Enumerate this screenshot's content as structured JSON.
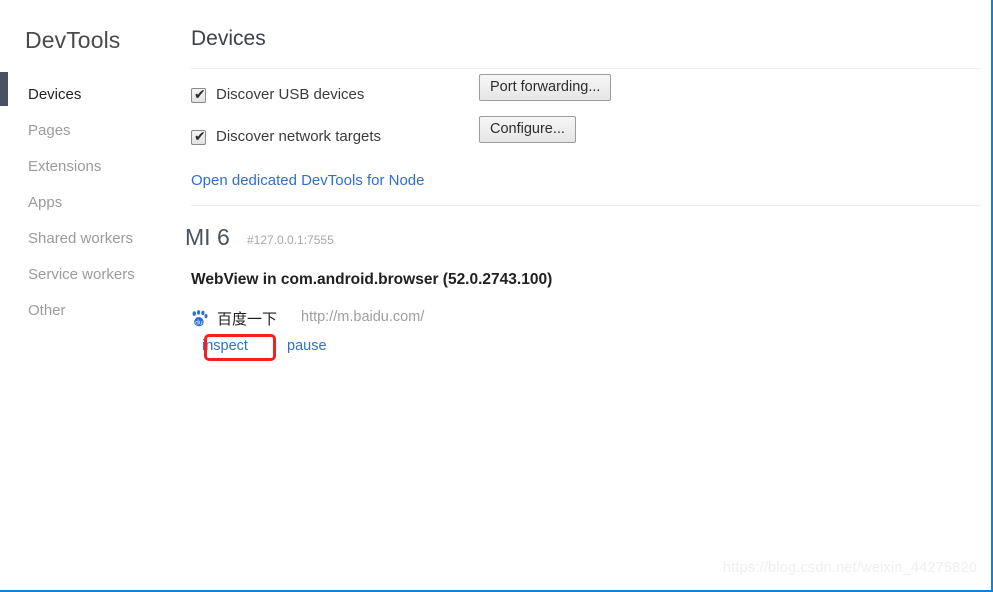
{
  "sidebar": {
    "brand": "DevTools",
    "items": [
      {
        "label": "Devices",
        "name": "sidebar-item-devices"
      },
      {
        "label": "Pages",
        "name": "sidebar-item-pages"
      },
      {
        "label": "Extensions",
        "name": "sidebar-item-extensions"
      },
      {
        "label": "Apps",
        "name": "sidebar-item-apps"
      },
      {
        "label": "Shared workers",
        "name": "sidebar-item-shared-workers"
      },
      {
        "label": "Service workers",
        "name": "sidebar-item-service-workers"
      },
      {
        "label": "Other",
        "name": "sidebar-item-other"
      }
    ],
    "selected_index": 0
  },
  "main": {
    "title": "Devices",
    "discover_usb": {
      "label": "Discover USB devices",
      "checked": true,
      "check_glyph": "✔"
    },
    "discover_network": {
      "label": "Discover network targets",
      "checked": true,
      "check_glyph": "✔"
    },
    "buttons": {
      "port_forwarding": "Port forwarding...",
      "configure": "Configure..."
    },
    "node_link": "Open dedicated DevTools for Node",
    "device": {
      "name": "MI 6",
      "address": "#127.0.0.1:7555",
      "browser": "WebView in com.android.browser (52.0.2743.100)",
      "targets": [
        {
          "favicon": "baidu-paw-icon",
          "title": "百度一下",
          "url": "http://m.baidu.com/",
          "actions": {
            "inspect": "inspect",
            "pause": "pause"
          }
        }
      ]
    }
  },
  "annotation": {
    "highlight_target": "inspect",
    "color": "#f61f1f"
  },
  "watermark": "https://blog.csdn.net/weixin_44275820",
  "colors": {
    "link": "#2f6fd0",
    "selection_bar": "#4a5260",
    "frame": "#1a7fd4",
    "annotation": "#f61f1f"
  }
}
